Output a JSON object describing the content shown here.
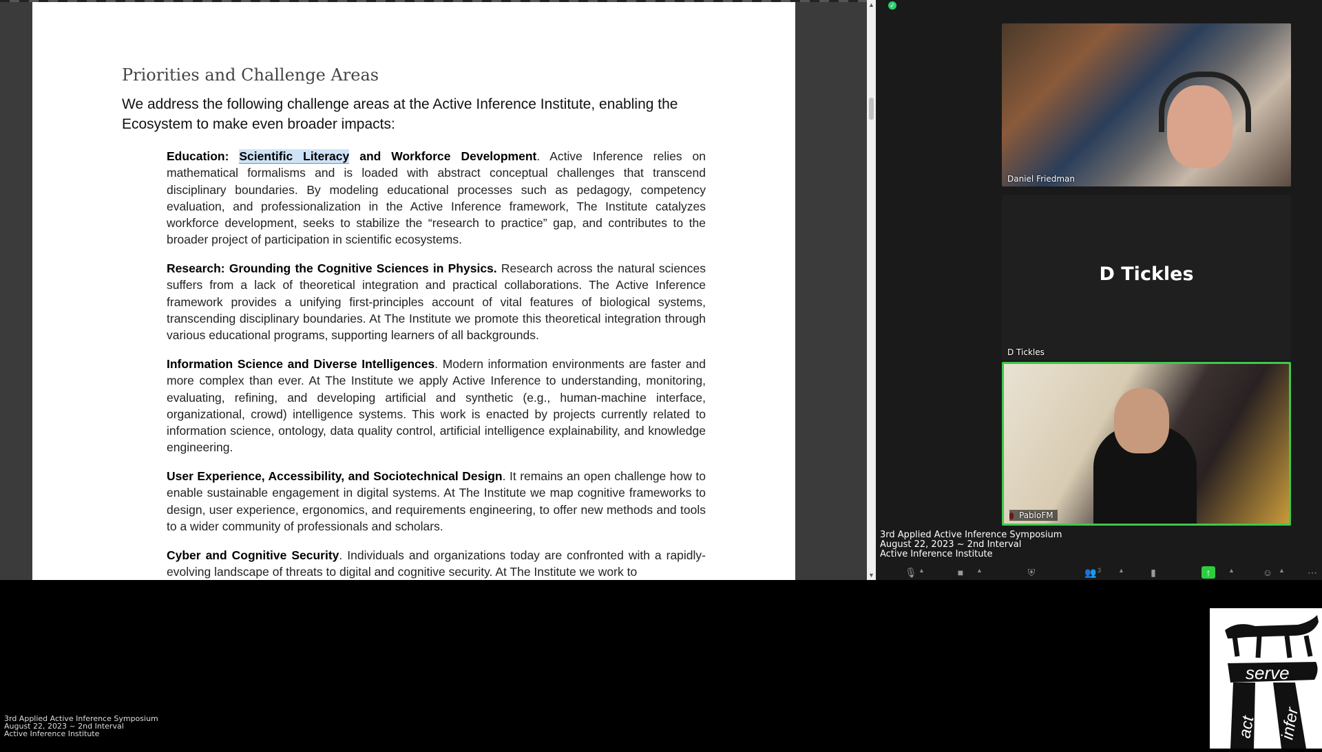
{
  "document": {
    "heading": "Priorities and Challenge Areas",
    "intro": "We address the following challenge areas at the Active Inference Institute, enabling the Ecosystem to make even broader impacts:",
    "areas": [
      {
        "title_prefix": "Education: ",
        "title_highlight": "Scientific Literacy",
        "title_suffix": " and Workforce Development",
        "body": ". Active Inference relies on mathematical formalisms and is loaded with abstract conceptual challenges that transcend disciplinary boundaries. By modeling educational processes such as pedagogy, competency evaluation, and professionalization in the Active Inference framework, The Institute catalyzes workforce development, seeks to stabilize the “research to practice” gap, and contributes to the broader project of participation in scientific ecosystems."
      },
      {
        "title": "Research: Grounding the Cognitive Sciences in Physics.",
        "body": " Research across the natural sciences suffers from a lack of theoretical integration and practical collaborations. The Active Inference framework provides a unifying first-principles account of vital features of biological systems, transcending disciplinary boundaries. At The Institute we promote this theoretical integration through various educational programs, supporting learners of all backgrounds."
      },
      {
        "title": "Information Science and Diverse Intelligences",
        "body": ". Modern information environments are faster and more complex than ever. At The Institute we apply Active Inference to understanding, monitoring, evaluating, refining, and developing artificial and synthetic (e.g., human-machine interface, organizational, crowd) intelligence systems. This work is enacted by projects currently related to information science, ontology, data quality control, artificial intelligence explainability, and knowledge engineering."
      },
      {
        "title": "User Experience, Accessibility, and Sociotechnical Design",
        "body": ". It remains an open challenge how to enable sustainable engagement in digital systems. At The Institute we map cognitive frameworks to design, user experience, ergonomics, and requirements engineering, to offer new methods and tools to a wider community of professionals and scholars."
      },
      {
        "title": "Cyber and Cognitive Security",
        "body": ". Individuals and organizations today are confronted with a rapidly-evolving landscape of threats to digital and cognitive security. At The Institute we work to"
      }
    ]
  },
  "zoom": {
    "participants": [
      {
        "name": "Daniel Friedman"
      },
      {
        "name": "D Tickles",
        "display": "D Tickles"
      },
      {
        "name": "PabloFM"
      }
    ],
    "event_info": {
      "line1": "3rd Applied Active Inference Symposium",
      "line2": "August 22, 2023 ~ 2nd Interval",
      "line3": "Active Inference Institute"
    },
    "toolbar": {
      "participants_count": "3"
    },
    "active_speaker_color": "#3ec94a"
  },
  "bottom_info": {
    "line1": "3rd Applied Active Inference Symposium",
    "line2": "August 22, 2023 ~ 2nd Interval",
    "line3": "Active Inference Institute"
  },
  "logo": {
    "word_serve": "serve",
    "word_act": "act",
    "word_infer": "infer"
  }
}
